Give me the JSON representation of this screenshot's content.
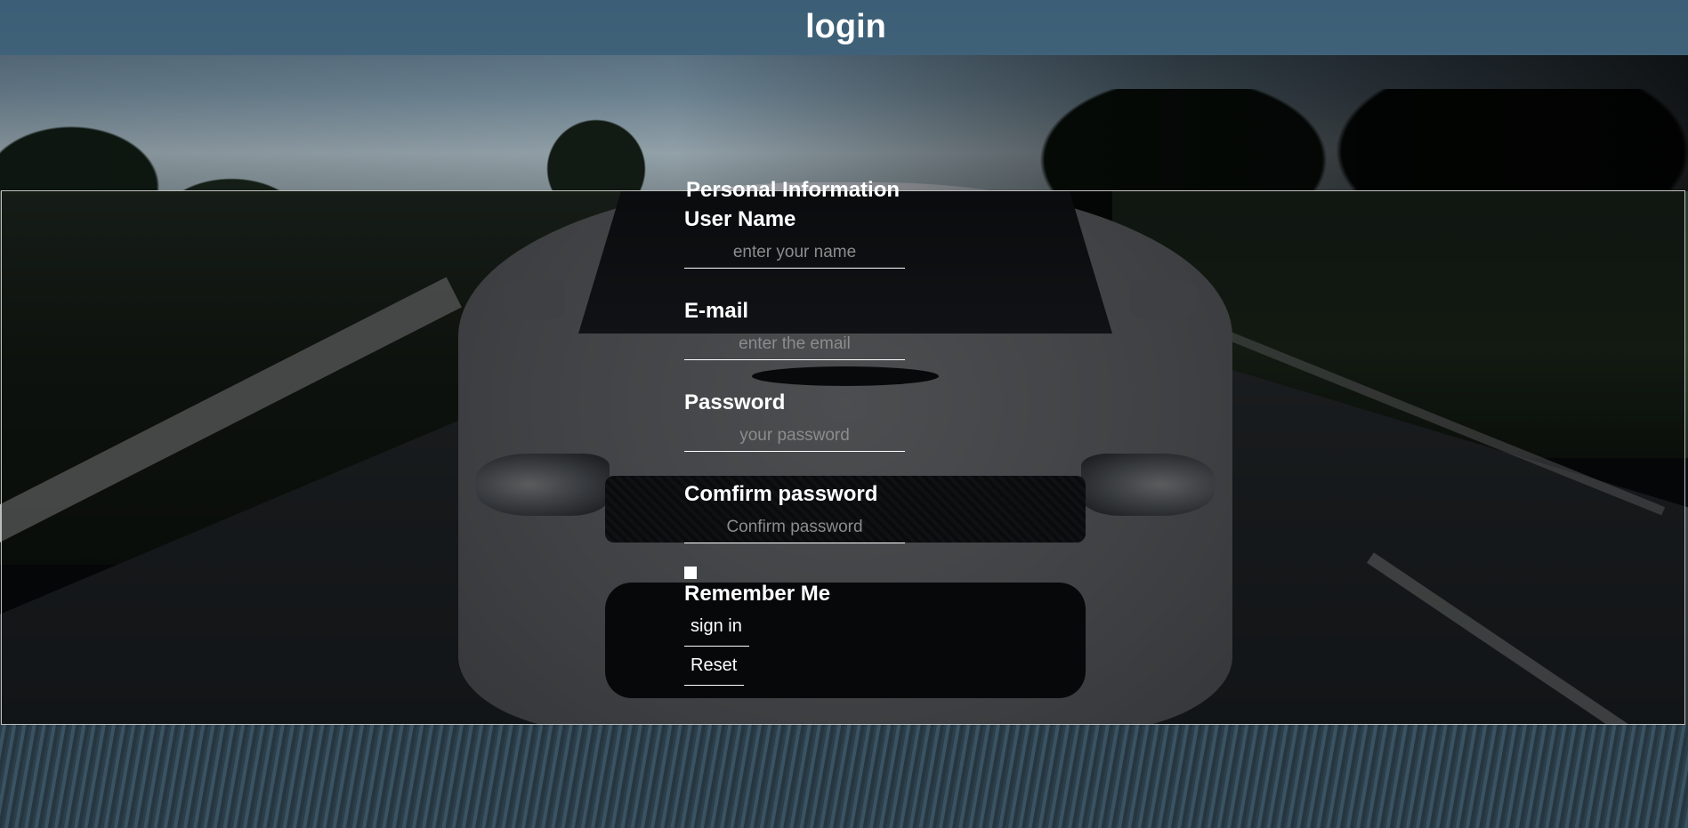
{
  "header": {
    "title": "login"
  },
  "form": {
    "legend": "Personal Information",
    "fields": [
      {
        "label": "User Name",
        "placeholder": "enter your name",
        "value": ""
      },
      {
        "label": "E-mail",
        "placeholder": "enter the email",
        "value": ""
      },
      {
        "label": "Password",
        "placeholder": "your password",
        "value": ""
      },
      {
        "label": "Comfirm password",
        "placeholder": "Confirm password",
        "value": ""
      }
    ],
    "remember": {
      "label": "Remember Me",
      "checked": false
    },
    "buttons": {
      "sign_in": "sign in",
      "reset": "Reset"
    }
  },
  "colors": {
    "header_bg": "#3a5e76",
    "text": "#ffffff",
    "placeholder": "#8c8c8c",
    "panel_border": "#c0c0c0"
  }
}
